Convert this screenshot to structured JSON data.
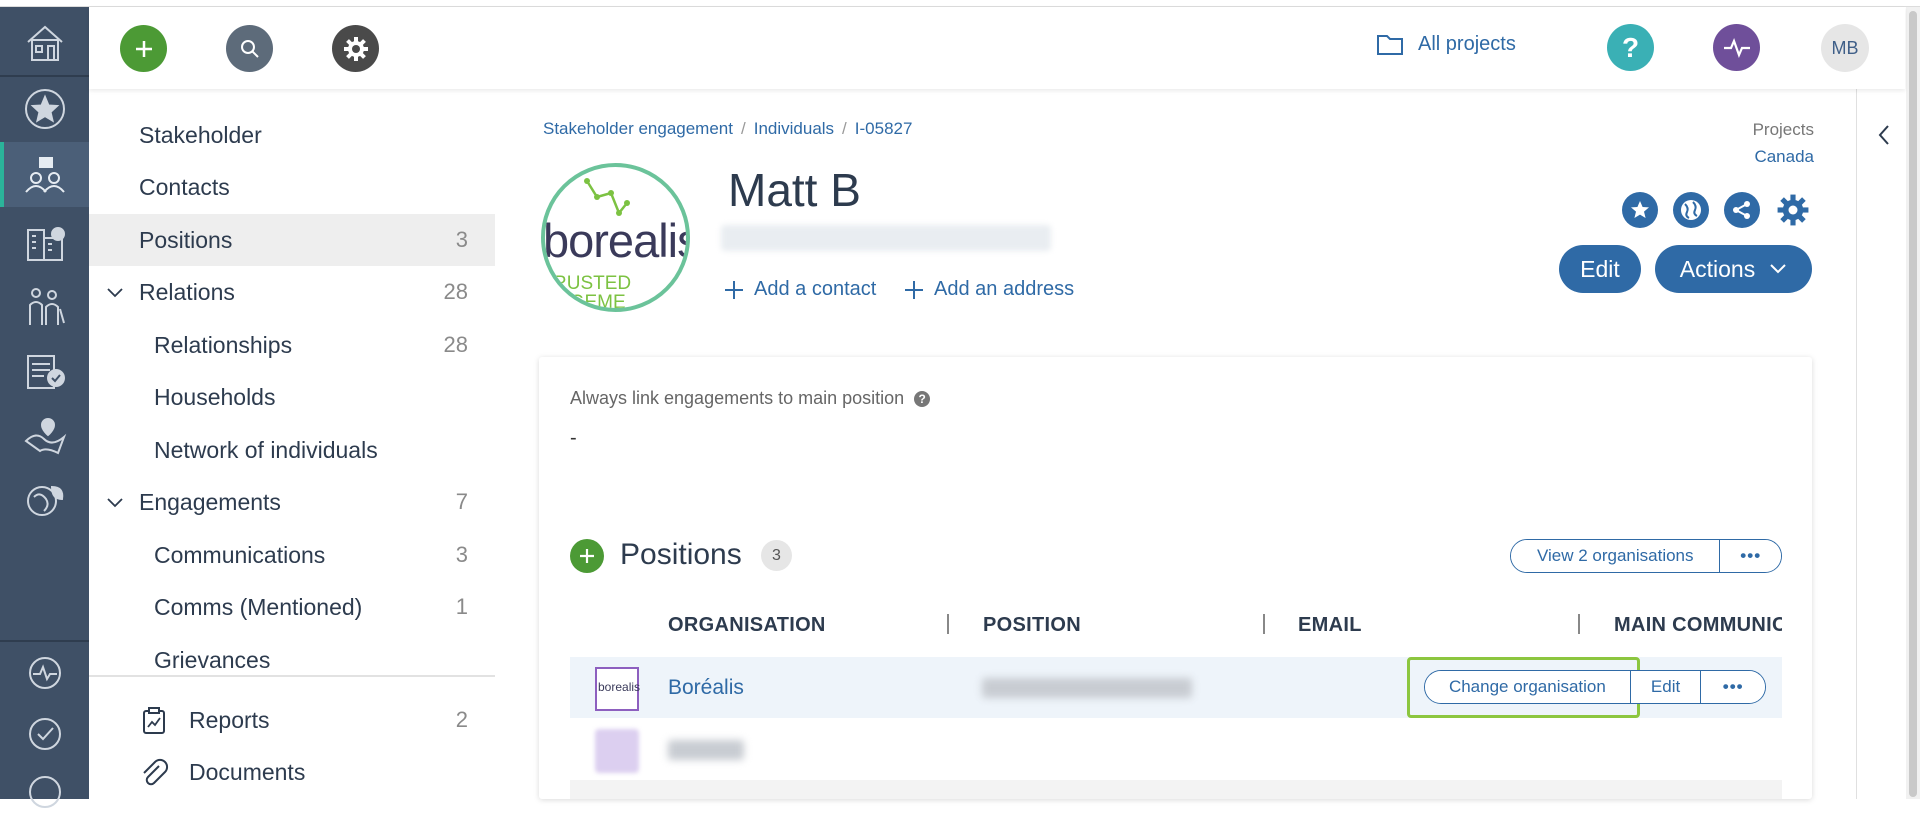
{
  "topbar": {
    "all_projects": "All projects",
    "avatar_initials": "MB"
  },
  "subnav": {
    "items": [
      {
        "label": "Stakeholder",
        "count": ""
      },
      {
        "label": "Contacts",
        "count": ""
      },
      {
        "label": "Positions",
        "count": "3"
      },
      {
        "label": "Relations",
        "count": "28"
      },
      {
        "label": "Relationships",
        "count": "28"
      },
      {
        "label": "Households",
        "count": ""
      },
      {
        "label": "Network of individuals",
        "count": ""
      },
      {
        "label": "Engagements",
        "count": "7"
      },
      {
        "label": "Communications",
        "count": "3"
      },
      {
        "label": "Comms (Mentioned)",
        "count": "1"
      },
      {
        "label": "Grievances",
        "count": ""
      },
      {
        "label": "Reports",
        "count": "2"
      },
      {
        "label": "Documents",
        "count": ""
      }
    ]
  },
  "breadcrumb": {
    "items": [
      "Stakeholder engagement",
      "Individuals",
      "I-05827"
    ],
    "separator": "/"
  },
  "projects": {
    "label": "Projects",
    "value": "Canada"
  },
  "profile": {
    "name": "Matt B",
    "logo_text": "borealis",
    "logo_tagline_1": "RUSTED",
    "logo_tagline_2": "AGEME",
    "add_contact": "Add a contact",
    "add_address": "Add an address"
  },
  "header_actions": {
    "edit": "Edit",
    "actions": "Actions"
  },
  "card": {
    "link_label": "Always link engagements to main position",
    "link_value": "-"
  },
  "positions": {
    "title": "Positions",
    "count": "3",
    "view_orgs": "View 2 organisations",
    "more": "•••",
    "columns": [
      "ORGANISATION",
      "POSITION",
      "EMAIL",
      "MAIN COMMUNIC"
    ],
    "rows": [
      {
        "organisation": "Boréalis",
        "change_org": "Change organisation",
        "edit": "Edit",
        "more": "•••"
      }
    ]
  },
  "colors": {
    "rail": "#3f5066",
    "accent_blue": "#2f6aa6",
    "green": "#4c9a35",
    "highlight": "#8cc63f"
  }
}
